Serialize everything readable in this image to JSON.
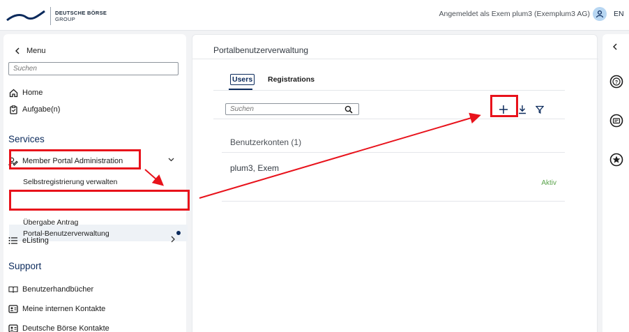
{
  "header": {
    "brand_line1": "DEUTSCHE BÖRSE",
    "brand_line2": "GROUP",
    "user_text": "Angemeldet als Exem plum3 (Exemplum3 AG)",
    "lang": "EN"
  },
  "sidebar": {
    "back_label": "Menu",
    "search_placeholder": "Suchen",
    "home": "Home",
    "tasks": "Aufgabe(n)",
    "services_title": "Services",
    "mpa": "Member Portal Administration",
    "sub1": "Selbstregistrierung verwalten",
    "sub2": "Portal-Benutzerverwaltung",
    "sub3": "Übergabe Antrag",
    "elisting": "eListing",
    "support_title": "Support",
    "manuals": "Benutzerhandbücher",
    "internal_contacts": "Meine internen Kontakte",
    "db_contacts": "Deutsche Börse Kontakte"
  },
  "main": {
    "page_title": "Portalbenutzerverwaltung",
    "tab_users": "Users",
    "tab_registrations": "Registrations",
    "search_placeholder": "Suchen",
    "accounts_heading": "Benutzerkonten (1)",
    "account_name": "plum3, Exem",
    "account_status": "Aktiv"
  },
  "colors": {
    "accent": "#0b2a5c",
    "annotation": "#e8121b",
    "status_ok": "#5aa34b"
  },
  "icons": [
    "chevron-left-icon",
    "home-icon",
    "clipboard-icon",
    "people-edit-icon",
    "chevron-down-icon",
    "list-icon",
    "chevron-right-icon",
    "book-icon",
    "contact-card-icon",
    "search-icon",
    "plus-icon",
    "download-icon",
    "filter-icon",
    "help-icon",
    "id-card-icon",
    "star-icon",
    "user-icon"
  ]
}
